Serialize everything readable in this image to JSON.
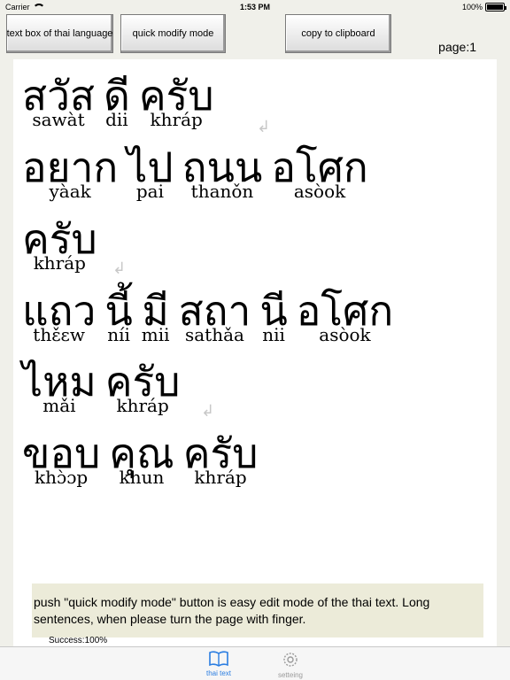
{
  "status_bar": {
    "carrier": "Carrier",
    "time": "1:53 PM",
    "battery_percent": "100%",
    "battery_level": 1.0
  },
  "toolbar": {
    "text_box_label": "text box of thai language",
    "quick_modify_label": "quick modify mode",
    "copy_label": "copy to clipboard"
  },
  "page_indicator": "page:1",
  "lines": [
    {
      "words": [
        {
          "thai": "สวัส",
          "roman": "sawàt"
        },
        {
          "thai": "ดี",
          "roman": "dii"
        },
        {
          "thai": "ครับ",
          "roman": "khráp"
        }
      ],
      "return_mark": "↲"
    },
    {
      "words": [
        {
          "thai": "อยาก",
          "roman": "yàak"
        },
        {
          "thai": "ไป",
          "roman": "pai"
        },
        {
          "thai": "ถนน",
          "roman": "thanǒn"
        },
        {
          "thai": "อโศก",
          "roman": "asòok"
        }
      ],
      "return_mark": ""
    },
    {
      "words": [
        {
          "thai": "ครับ",
          "roman": "khráp"
        }
      ],
      "return_mark": "↲"
    },
    {
      "words": [
        {
          "thai": "แถว",
          "roman": "thɛ̌ɛw"
        },
        {
          "thai": "นี้",
          "roman": "níi"
        },
        {
          "thai": "มี",
          "roman": "mii"
        },
        {
          "thai": "สถา",
          "roman": "sathǎa"
        },
        {
          "thai": "นี",
          "roman": "nii"
        },
        {
          "thai": "อโศก",
          "roman": "asòok"
        }
      ],
      "return_mark": ""
    },
    {
      "words": [
        {
          "thai": "ไหม",
          "roman": "mǎi"
        },
        {
          "thai": "ครับ",
          "roman": "khráp"
        }
      ],
      "return_mark": "↲"
    },
    {
      "words": [
        {
          "thai": "ขอบ",
          "roman": "khɔ̀ɔp"
        },
        {
          "thai": "คุณ",
          "roman": "khun"
        },
        {
          "thai": "ครับ",
          "roman": "khráp"
        }
      ],
      "return_mark": ""
    }
  ],
  "hint_text": "push \"quick modify mode\" button is easy edit mode of the thai text. Long sentences, when please turn the page with finger.",
  "success_text": "Success:100%",
  "tabs": [
    {
      "label": "thai text",
      "icon": "book-icon",
      "active": true,
      "color": "#2a7de1"
    },
    {
      "label": "setteing",
      "icon": "gear-icon",
      "active": false,
      "color": "#9a9a9a"
    }
  ]
}
